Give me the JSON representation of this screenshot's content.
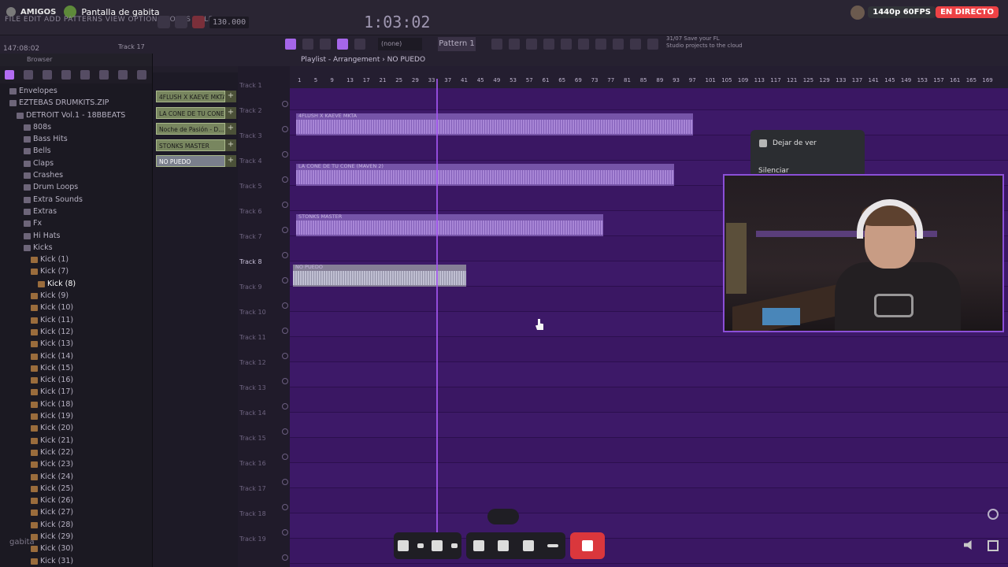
{
  "stream": {
    "server_label": "AMIGOS",
    "title": "Pantalla de gabita",
    "quality_badge": "1440p 60FPS",
    "live_badge": "EN DIRECTO",
    "colors": {
      "live": "#ed4245",
      "accent": "#8b4fd8"
    }
  },
  "fl": {
    "menu": "FILE  EDIT  ADD  PATTERNS  VIEW  OPTIONS  TOOLS  HELP",
    "time": "1:03:02",
    "tempo": "130.000",
    "hint_time": "147:08:02",
    "hint_track": "Track 17",
    "pattern_selector": "(none)",
    "pattern_name": "Pattern 1",
    "cloud_hint_line1": "31/07  Save your FL",
    "cloud_hint_line2": "Studio projects to the cloud"
  },
  "browser": {
    "title": "Browser",
    "footer_user": "gabita",
    "items": [
      {
        "label": "Envelopes",
        "indent": 0,
        "type": "folder"
      },
      {
        "label": "EZTEBAS DRUMKITS.ZIP",
        "indent": 0,
        "type": "folder"
      },
      {
        "label": "DETROIT Vol.1 - 18BBEATS",
        "indent": 1,
        "type": "folder"
      },
      {
        "label": "808s",
        "indent": 2,
        "type": "folder"
      },
      {
        "label": "Bass Hits",
        "indent": 2,
        "type": "folder"
      },
      {
        "label": "Bells",
        "indent": 2,
        "type": "folder"
      },
      {
        "label": "Claps",
        "indent": 2,
        "type": "folder"
      },
      {
        "label": "Crashes",
        "indent": 2,
        "type": "folder"
      },
      {
        "label": "Drum Loops",
        "indent": 2,
        "type": "folder"
      },
      {
        "label": "Extra Sounds",
        "indent": 2,
        "type": "folder"
      },
      {
        "label": "Extras",
        "indent": 2,
        "type": "folder"
      },
      {
        "label": "Fx",
        "indent": 2,
        "type": "folder"
      },
      {
        "label": "Hi Hats",
        "indent": 2,
        "type": "folder"
      },
      {
        "label": "Kicks",
        "indent": 2,
        "type": "folder"
      },
      {
        "label": "Kick (1)",
        "indent": 3,
        "type": "file"
      },
      {
        "label": "Kick (7)",
        "indent": 3,
        "type": "file"
      },
      {
        "label": "Kick (8)",
        "indent": 4,
        "type": "file",
        "selected": true
      },
      {
        "label": "Kick (9)",
        "indent": 3,
        "type": "file"
      },
      {
        "label": "Kick (10)",
        "indent": 3,
        "type": "file"
      },
      {
        "label": "Kick (11)",
        "indent": 3,
        "type": "file"
      },
      {
        "label": "Kick (12)",
        "indent": 3,
        "type": "file"
      },
      {
        "label": "Kick (13)",
        "indent": 3,
        "type": "file"
      },
      {
        "label": "Kick (14)",
        "indent": 3,
        "type": "file"
      },
      {
        "label": "Kick (15)",
        "indent": 3,
        "type": "file"
      },
      {
        "label": "Kick (16)",
        "indent": 3,
        "type": "file"
      },
      {
        "label": "Kick (17)",
        "indent": 3,
        "type": "file"
      },
      {
        "label": "Kick (18)",
        "indent": 3,
        "type": "file"
      },
      {
        "label": "Kick (19)",
        "indent": 3,
        "type": "file"
      },
      {
        "label": "Kick (20)",
        "indent": 3,
        "type": "file"
      },
      {
        "label": "Kick (21)",
        "indent": 3,
        "type": "file"
      },
      {
        "label": "Kick (22)",
        "indent": 3,
        "type": "file"
      },
      {
        "label": "Kick (23)",
        "indent": 3,
        "type": "file"
      },
      {
        "label": "Kick (24)",
        "indent": 3,
        "type": "file"
      },
      {
        "label": "Kick (25)",
        "indent": 3,
        "type": "file"
      },
      {
        "label": "Kick (26)",
        "indent": 3,
        "type": "file"
      },
      {
        "label": "Kick (27)",
        "indent": 3,
        "type": "file"
      },
      {
        "label": "Kick (28)",
        "indent": 3,
        "type": "file"
      },
      {
        "label": "Kick (29)",
        "indent": 3,
        "type": "file"
      },
      {
        "label": "Kick (30)",
        "indent": 3,
        "type": "file"
      },
      {
        "label": "Kick (31)",
        "indent": 3,
        "type": "file"
      }
    ]
  },
  "picker": [
    {
      "label": "4FLUSH X KAEVE MKTA",
      "selected": false
    },
    {
      "label": "LA CONE DE TU CONE (...",
      "selected": false
    },
    {
      "label": "Noche de Pasión - D...",
      "selected": false
    },
    {
      "label": "STONKS MASTER",
      "selected": false
    },
    {
      "label": "NO PUEDO",
      "selected": true
    }
  ],
  "playlist": {
    "title": "Playlist - Arrangement › NO PUEDO",
    "ruler": [
      "1",
      "5",
      "9",
      "13",
      "17",
      "21",
      "25",
      "29",
      "33",
      "37",
      "41",
      "45",
      "49",
      "53",
      "57",
      "61",
      "65",
      "69",
      "73",
      "77",
      "81",
      "85",
      "89",
      "93",
      "97",
      "101",
      "105",
      "109",
      "113",
      "117",
      "121",
      "125",
      "129",
      "133",
      "137",
      "141",
      "145",
      "149",
      "153",
      "157",
      "161",
      "165",
      "169"
    ],
    "tracks": [
      "Track 1",
      "Track 2",
      "Track 3",
      "Track 4",
      "Track 5",
      "Track 6",
      "Track 7",
      "Track 8",
      "Track 9",
      "Track 10",
      "Track 11",
      "Track 12",
      "Track 13",
      "Track 14",
      "Track 15",
      "Track 16",
      "Track 17",
      "Track 18",
      "Track 19"
    ],
    "active_track": "Track 8",
    "clips": [
      {
        "title": "4FLUSH X KAEVE MKTA",
        "track": 1
      },
      {
        "title": "LA CONE DE TU CONE (MAVEN 2)",
        "track": 3
      },
      {
        "title": "STONKS MASTER",
        "track": 5
      },
      {
        "title": "NO PUEDO",
        "track": 7,
        "selected": true
      }
    ]
  },
  "popup": {
    "unfollow": "Dejar de ver",
    "mute": "Silenciar"
  },
  "call_bar": [
    "microphone-icon",
    "camera-off-icon",
    "screen-share-icon",
    "activities-icon",
    "soundboard-icon",
    "more-icon",
    "leave-call-icon"
  ]
}
